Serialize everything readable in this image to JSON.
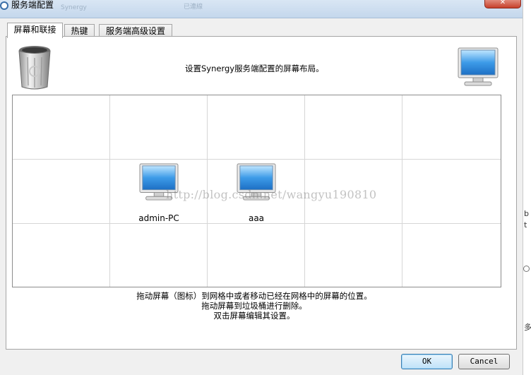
{
  "window": {
    "title": "服务端配置",
    "ghost_text_1": "Synergy",
    "ghost_text_2": "已連線",
    "close_label": "✕"
  },
  "tabs": [
    {
      "label": "屏幕和联接",
      "active": true
    },
    {
      "label": "热键",
      "active": false
    },
    {
      "label": "服务端高级设置",
      "active": false
    }
  ],
  "layout_panel": {
    "heading": "设置Synergy服务端配置的屏幕布局。",
    "trash_icon": "recycle-bin-icon",
    "new_screen_icon": "monitor-icon"
  },
  "grid": {
    "rows": 3,
    "cols": 5,
    "screens": [
      {
        "name": "admin-PC",
        "row": 1,
        "col": 1
      },
      {
        "name": "aaa",
        "row": 1,
        "col": 2
      }
    ]
  },
  "watermark": "http://blog.csdn.net/wangyu190810",
  "instructions": [
    "拖动屏幕（图标）到网格中或者移动已经在网格中的屏幕的位置。",
    "拖动屏幕到垃圾桶进行删除。",
    "双击屏幕编辑其设置。"
  ],
  "buttons": {
    "ok": "OK",
    "cancel": "Cancel"
  },
  "right_strip": {
    "char_1": "b",
    "char_2": "t",
    "char_3": "多"
  },
  "colors": {
    "monitor_blue": "#2f8fe0",
    "title_bar": "#c4d7ec",
    "close_red": "#c7402b"
  }
}
